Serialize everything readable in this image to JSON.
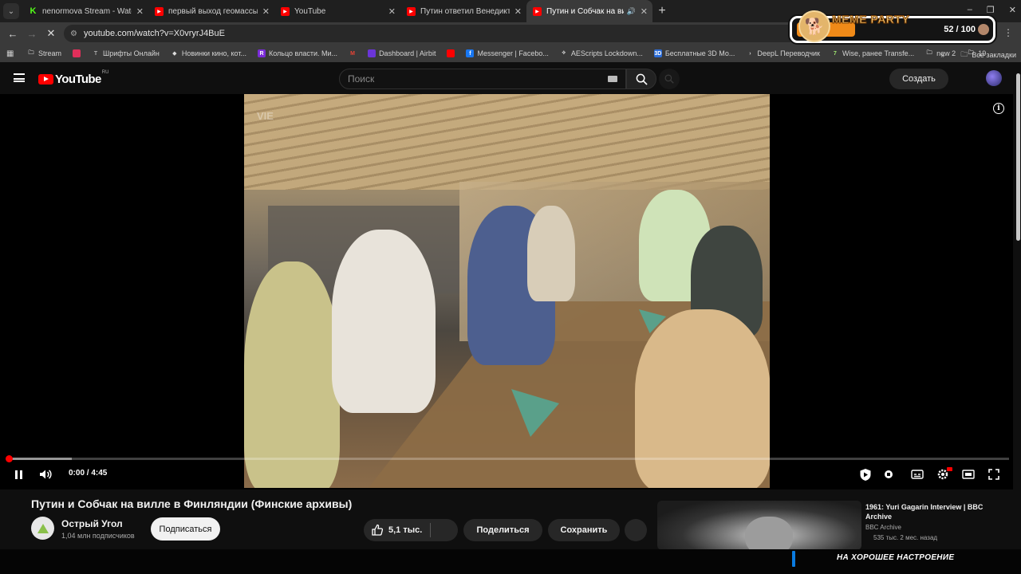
{
  "browser": {
    "tabs": [
      {
        "title": "nenormova Stream - Watch Live",
        "favicon": "kick-icon",
        "active": false
      },
      {
        "title": "первый выход геомассыча - YouTube",
        "favicon": "youtube-icon",
        "active": false
      },
      {
        "title": "YouTube",
        "favicon": "youtube-icon",
        "active": false
      },
      {
        "title": "Путин ответил Венедиктову - YouTube",
        "favicon": "youtube-icon",
        "active": false
      },
      {
        "title": "Путин и Собчак на вилле в Финляндии",
        "favicon": "youtube-icon",
        "active": true
      }
    ],
    "url": "youtube.com/watch?v=X0vryrJ4BuE",
    "bookmarks": [
      {
        "label": "Stream",
        "icon": "folder-icon"
      },
      {
        "label": "",
        "icon": "red-badge-icon"
      },
      {
        "label": "Шрифты Онлайн",
        "icon": "font-icon"
      },
      {
        "label": "Новинки кино, кот...",
        "icon": "film-icon"
      },
      {
        "label": "Кольцо власти. Ми...",
        "icon": "r-icon"
      },
      {
        "label": "",
        "icon": "gmail-icon"
      },
      {
        "label": "Dashboard | Airbit",
        "icon": "airbit-icon"
      },
      {
        "label": "",
        "icon": "youtube-icon"
      },
      {
        "label": "Messenger | Facebo...",
        "icon": "facebook-icon"
      },
      {
        "label": "AEScripts Lockdown...",
        "icon": "aescripts-icon"
      },
      {
        "label": "Бесплатные 3D Мо...",
        "icon": "3d-icon"
      },
      {
        "label": "DeepL Переводчик",
        "icon": "deepl-icon"
      },
      {
        "label": "Wise, ранее Transfe...",
        "icon": "wise-icon"
      },
      {
        "label": "new 2",
        "icon": "folder-icon"
      },
      {
        "label": "19",
        "icon": "folder-icon"
      }
    ],
    "all_bookmarks": "Все закладки"
  },
  "overlay": {
    "label": "MEME PARTY",
    "count": "52 / 100",
    "progress": 0.52
  },
  "youtube": {
    "logo_text": "YouTube",
    "country": "RU",
    "search_placeholder": "Поиск",
    "create_label": "Создать"
  },
  "player": {
    "watermark": "VIE",
    "time": "0:00 / 4:45",
    "progress": 0.0
  },
  "video": {
    "title": "Путин и Собчак на вилле в Финляндии (Финские архивы)",
    "channel": "Острый Угол",
    "subscribers": "1,04 млн подписчиков",
    "subscribe_label": "Подписаться",
    "likes": "5,1 тыс.",
    "share_label": "Поделиться",
    "save_label": "Сохранить"
  },
  "recommendation": {
    "title": "1961: Yuri Gagarin Interview | BBC Archive",
    "channel": "BBC Archive",
    "meta": "535 тыс.  2 мес. назад"
  },
  "bottom_caption": "НА ХОРОШЕЕ НАСТРОЕНИЕ",
  "colors": {
    "accent_red": "#ff0000",
    "overlay_orange": "#f08a18",
    "background": "#0f0f0f"
  }
}
